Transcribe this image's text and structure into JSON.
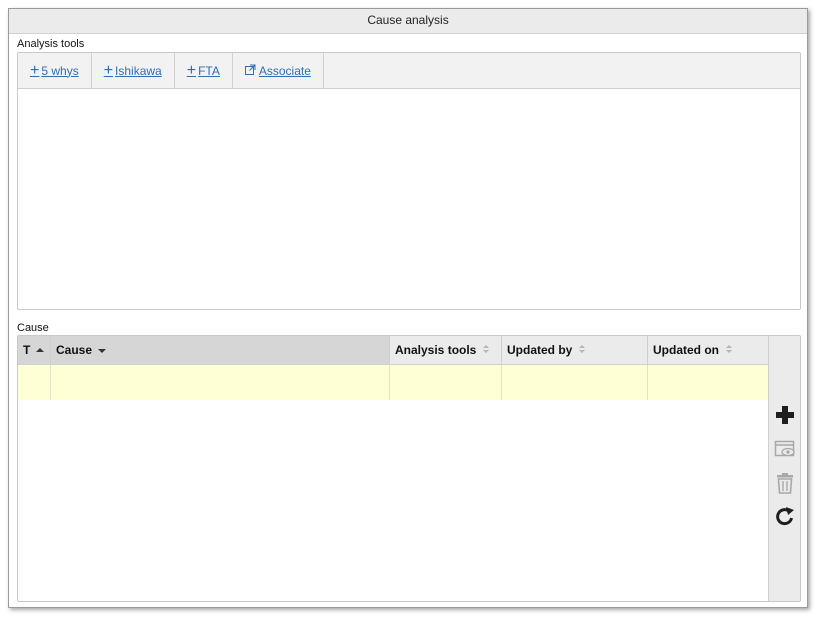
{
  "window": {
    "title": "Cause analysis"
  },
  "analysis_tools": {
    "label": "Analysis tools",
    "buttons": [
      {
        "label": "5 whys",
        "icon": "plus-icon"
      },
      {
        "label": "Ishikawa",
        "icon": "plus-icon"
      },
      {
        "label": "FTA",
        "icon": "plus-icon"
      },
      {
        "label": "Associate",
        "icon": "external-link-icon"
      }
    ]
  },
  "cause": {
    "label": "Cause",
    "columns": [
      {
        "label": "T",
        "sort": "ascending"
      },
      {
        "label": "Cause",
        "sort": "descending"
      },
      {
        "label": "Analysis tools",
        "sort": "none"
      },
      {
        "label": "Updated by",
        "sort": "none"
      },
      {
        "label": "Updated on",
        "sort": "none"
      }
    ],
    "rows": [
      {
        "t": "",
        "cause": "",
        "analysis_tools": "",
        "updated_by": "",
        "updated_on": ""
      }
    ],
    "actions": [
      {
        "name": "add",
        "icon": "plus-icon",
        "enabled": true
      },
      {
        "name": "view",
        "icon": "view-icon",
        "enabled": false
      },
      {
        "name": "delete",
        "icon": "trash-icon",
        "enabled": false
      },
      {
        "name": "refresh",
        "icon": "refresh-icon",
        "enabled": true
      }
    ]
  },
  "colors": {
    "link": "#2f6fb0",
    "selected_row": "#ffffd6",
    "header_bg": "#ebebeb",
    "sorted_col_bg": "#d6d6d6"
  }
}
